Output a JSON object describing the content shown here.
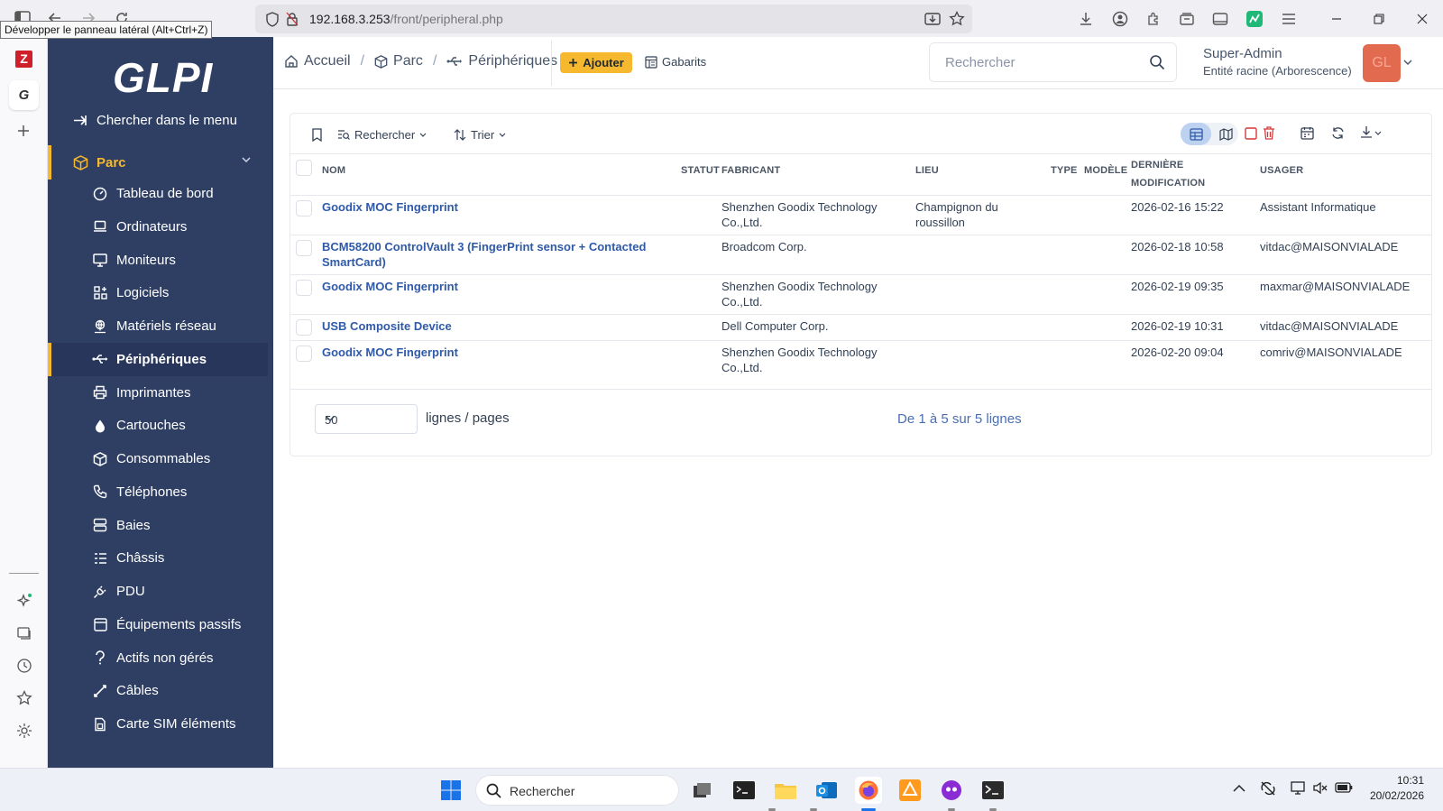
{
  "browser": {
    "url_host": "192.168.3.253",
    "url_path": "/front/peripheral.php",
    "tooltip": "Développer le panneau latéral (Alt+Ctrl+Z)"
  },
  "sidebar": {
    "logo": "GLPI",
    "search_menu": "Chercher dans le menu",
    "section": "Parc",
    "items": [
      {
        "label": "Tableau de bord",
        "icon": "dashboard-icon"
      },
      {
        "label": "Ordinateurs",
        "icon": "laptop-icon"
      },
      {
        "label": "Moniteurs",
        "icon": "monitor-icon"
      },
      {
        "label": "Logiciels",
        "icon": "apps-icon"
      },
      {
        "label": "Matériels réseau",
        "icon": "network-icon"
      },
      {
        "label": "Périphériques",
        "icon": "usb-icon"
      },
      {
        "label": "Imprimantes",
        "icon": "printer-icon"
      },
      {
        "label": "Cartouches",
        "icon": "droplet-icon"
      },
      {
        "label": "Consommables",
        "icon": "box-icon"
      },
      {
        "label": "Téléphones",
        "icon": "phone-icon"
      },
      {
        "label": "Baies",
        "icon": "server-icon"
      },
      {
        "label": "Châssis",
        "icon": "chassis-icon"
      },
      {
        "label": "PDU",
        "icon": "plug-icon"
      },
      {
        "label": "Équipements passifs",
        "icon": "passive-icon"
      },
      {
        "label": "Actifs non gérés",
        "icon": "question-icon"
      },
      {
        "label": "Câbles",
        "icon": "cable-icon"
      },
      {
        "label": "Carte SIM éléments",
        "icon": "sim-icon"
      }
    ],
    "active_item": "Périphériques"
  },
  "header": {
    "breadcrumb": [
      "Accueil",
      "Parc",
      "Périphériques"
    ],
    "add_label": "Ajouter",
    "templates_label": "Gabarits",
    "search_placeholder": "Rechercher",
    "user_name": "Super-Admin",
    "user_entity": "Entité racine (Arborescence)",
    "avatar_initials": "GL"
  },
  "toolbar": {
    "search_label": "Rechercher",
    "sort_label": "Trier"
  },
  "table": {
    "columns": [
      "NOM",
      "STATUT",
      "FABRICANT",
      "LIEU",
      "TYPE",
      "MODÈLE",
      "DERNIÈRE",
      "MODIFICATION",
      "USAGER"
    ],
    "rows": [
      {
        "nom": [
          "Goodix MOC Fingerprint",
          ""
        ],
        "fabricant": [
          "Shenzhen Goodix Technology",
          "Co.,Ltd."
        ],
        "lieu": [
          "Champignon du",
          "roussillon"
        ],
        "modif": "2026-02-16 15:22",
        "usager": "Assistant Informatique"
      },
      {
        "nom": [
          "BCM58200 ControlVault 3 (FingerPrint sensor + Contacted",
          "SmartCard)"
        ],
        "fabricant": [
          "Broadcom Corp.",
          ""
        ],
        "lieu": [
          "",
          ""
        ],
        "modif": "2026-02-18 10:58",
        "usager": "vitdac@MAISONVIALADE"
      },
      {
        "nom": [
          "Goodix MOC Fingerprint",
          ""
        ],
        "fabricant": [
          "Shenzhen Goodix Technology",
          "Co.,Ltd."
        ],
        "lieu": [
          "",
          ""
        ],
        "modif": "2026-02-19 09:35",
        "usager": "maxmar@MAISONVIALADE"
      },
      {
        "nom": [
          "USB Composite Device",
          ""
        ],
        "fabricant": [
          "Dell Computer Corp.",
          ""
        ],
        "lieu": [
          "",
          ""
        ],
        "modif": "2026-02-19 10:31",
        "usager": "vitdac@MAISONVIALADE"
      },
      {
        "nom": [
          "Goodix MOC Fingerprint",
          ""
        ],
        "fabricant": [
          "Shenzhen Goodix Technology",
          "Co.,Ltd."
        ],
        "lieu": [
          "",
          ""
        ],
        "modif": "2026-02-20 09:04",
        "usager": "comriv@MAISONVIALADE"
      }
    ]
  },
  "pager": {
    "per_page": "50",
    "per_page_label": "lignes / pages",
    "info": "De 1 à 5 sur 5 lignes"
  },
  "taskbar": {
    "search_placeholder": "Rechercher",
    "time": "10:31",
    "date": "20/02/2026"
  }
}
